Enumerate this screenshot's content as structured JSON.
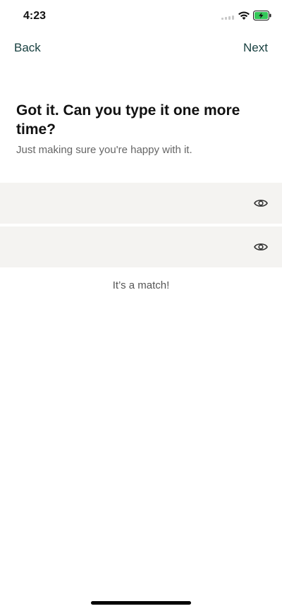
{
  "status_bar": {
    "time": "4:23"
  },
  "nav": {
    "back_label": "Back",
    "next_label": "Next"
  },
  "content": {
    "title": "Got it. Can you type it one more time?",
    "subtitle": "Just making sure you're happy with it.",
    "match_message": "It’s a match!"
  },
  "fields": [
    {
      "value": "",
      "placeholder": "",
      "icon": "eye-icon"
    },
    {
      "value": "",
      "placeholder": "",
      "icon": "eye-icon"
    }
  ],
  "colors": {
    "accent": "#173f3f",
    "field_background": "#f4f3f1",
    "battery": "#34c759"
  }
}
